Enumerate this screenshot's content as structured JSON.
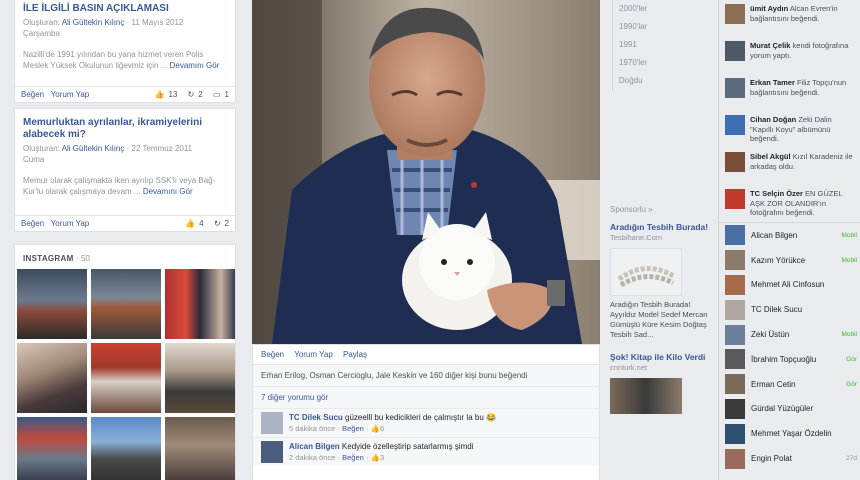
{
  "left": {
    "post1": {
      "title": "İLE İLGİLİ BASIN AÇIKLAMASI",
      "author_prefix": "Oluşturan:",
      "author": "Ali Gültekin Kılınç",
      "date": "11 Mayıs 2012",
      "day": "Çarşamba",
      "excerpt": "Nazilli'de 1991 yılından bu yana hizmet veren Polis Meslek Yüksek Okulunun liğevmiz için ...",
      "more": "Devamını Gör",
      "like": "Beğen",
      "comment": "Yorum Yap",
      "counts": [
        "13",
        "2",
        "1"
      ]
    },
    "post2": {
      "title": "Memurluktan ayrılanlar, ikramiyelerini alabecek mi?",
      "author_prefix": "Oluşturan:",
      "author": "Ali Gültekin Kılınç",
      "date": "22 Temmuz 2011",
      "day": "Cuma",
      "excerpt": "Memur olarak çalışmakta iken ayrılıp SSK'lı veya Bağ-Kur'lu olarak çalışmaya devam ...",
      "more": "Devamını Gör",
      "like": "Beğen",
      "comment": "Yorum Yap",
      "counts": [
        "4",
        "2"
      ]
    },
    "instagram": {
      "label": "INSTAGRAM",
      "count": "50"
    }
  },
  "center": {
    "actions": [
      "Beğen",
      "Yorum Yap",
      "Paylaş"
    ],
    "likes_line": "Erhan Erilog, Osman Cercioglu, Jale Keskin ve 160 diğer kişi bunu beğendi",
    "more_comments": "7 diğer yorumu gör",
    "comments": [
      {
        "name": "TC Dilek Sucu",
        "text": "güzeelll bu kedicikleri de çalmıştır la bu 😂",
        "time": "5 dakika önce",
        "like": "Beğen",
        "likes": "6"
      },
      {
        "name": "Alican Bilgen",
        "text": "Kedyide özelleştirip satarlarmış şimdi",
        "time": "2 dakika önce",
        "like": "Beğen",
        "likes": "3"
      }
    ]
  },
  "years": [
    "2000'ler",
    "1990'lar",
    "1991",
    "1970'ler",
    "Doğdu"
  ],
  "ads": {
    "sponsored": "Sponsorlu",
    "ad1": {
      "title": "Aradığın Tesbih Burada!",
      "url": "Tesbihane.Com",
      "body": "Aradığın Tesbih Burada! Ayyıldız Model Sedef Mercan Gümüşlü Küre Kesim Doğtaş Tesbih Sad..."
    },
    "ad2": {
      "title": "Şok! Kitap ile Kilo Verdi",
      "url": "cnnturk.net"
    }
  },
  "ticker": [
    {
      "name": "ümit Aydın",
      "text": "Alcan Evren'in bağlantısını beğendi.",
      "color": "#8a6e55"
    },
    {
      "name": "Murat Çelik",
      "text": "kendi fotoğrafına yorum yaptı.",
      "color": "#4d5a66"
    },
    {
      "name": "Erkan Tamer",
      "text": "Filiz Topçu'nun bağlantısını beğendi.",
      "color": "#5c6b7a"
    },
    {
      "name": "Cihan Doğan",
      "text": "Zeki Dalin \"Kapıllı Koyu\" albümünü beğendi.",
      "color": "#3d6fb3"
    },
    {
      "name": "Sibel Akgül",
      "text": "Kızıl Karadeniz ile arkadaş oldu.",
      "color": "#7a4c3a"
    },
    {
      "name": "TC Selçin Özer",
      "text": "EN GÜZEL AŞK ZOR OLANDIR'ın fotoğrafını beğendi.",
      "color": "#c0392b"
    }
  ],
  "chat": [
    {
      "name": "Alican Bilgen",
      "status": "Mobil",
      "color": "#4a6fa5"
    },
    {
      "name": "Kazım Yörükce",
      "status": "Mobil",
      "color": "#8c7a6b"
    },
    {
      "name": "Mehmet Ali Cinfosun",
      "status": "",
      "color": "#a56b4a"
    },
    {
      "name": "TC Dilek Sucu",
      "status": "",
      "color": "#b0a8a0"
    },
    {
      "name": "Zeki Üstün",
      "status": "Mobil",
      "color": "#6b7f9a"
    },
    {
      "name": "İbrahim Topçuoğlu",
      "status": "Gör",
      "color": "#5a5a5a"
    },
    {
      "name": "Erman Cetin",
      "status": "Gör",
      "color": "#7a6a5a"
    },
    {
      "name": "Gürdal Yüzügüler",
      "status": "",
      "color": "#3a3a3a"
    },
    {
      "name": "Mehmet Yaşar Özdelin",
      "status": "",
      "color": "#2f4f6f"
    },
    {
      "name": "Engin Polat",
      "status": "27d",
      "color": "#9a6a5a"
    }
  ]
}
